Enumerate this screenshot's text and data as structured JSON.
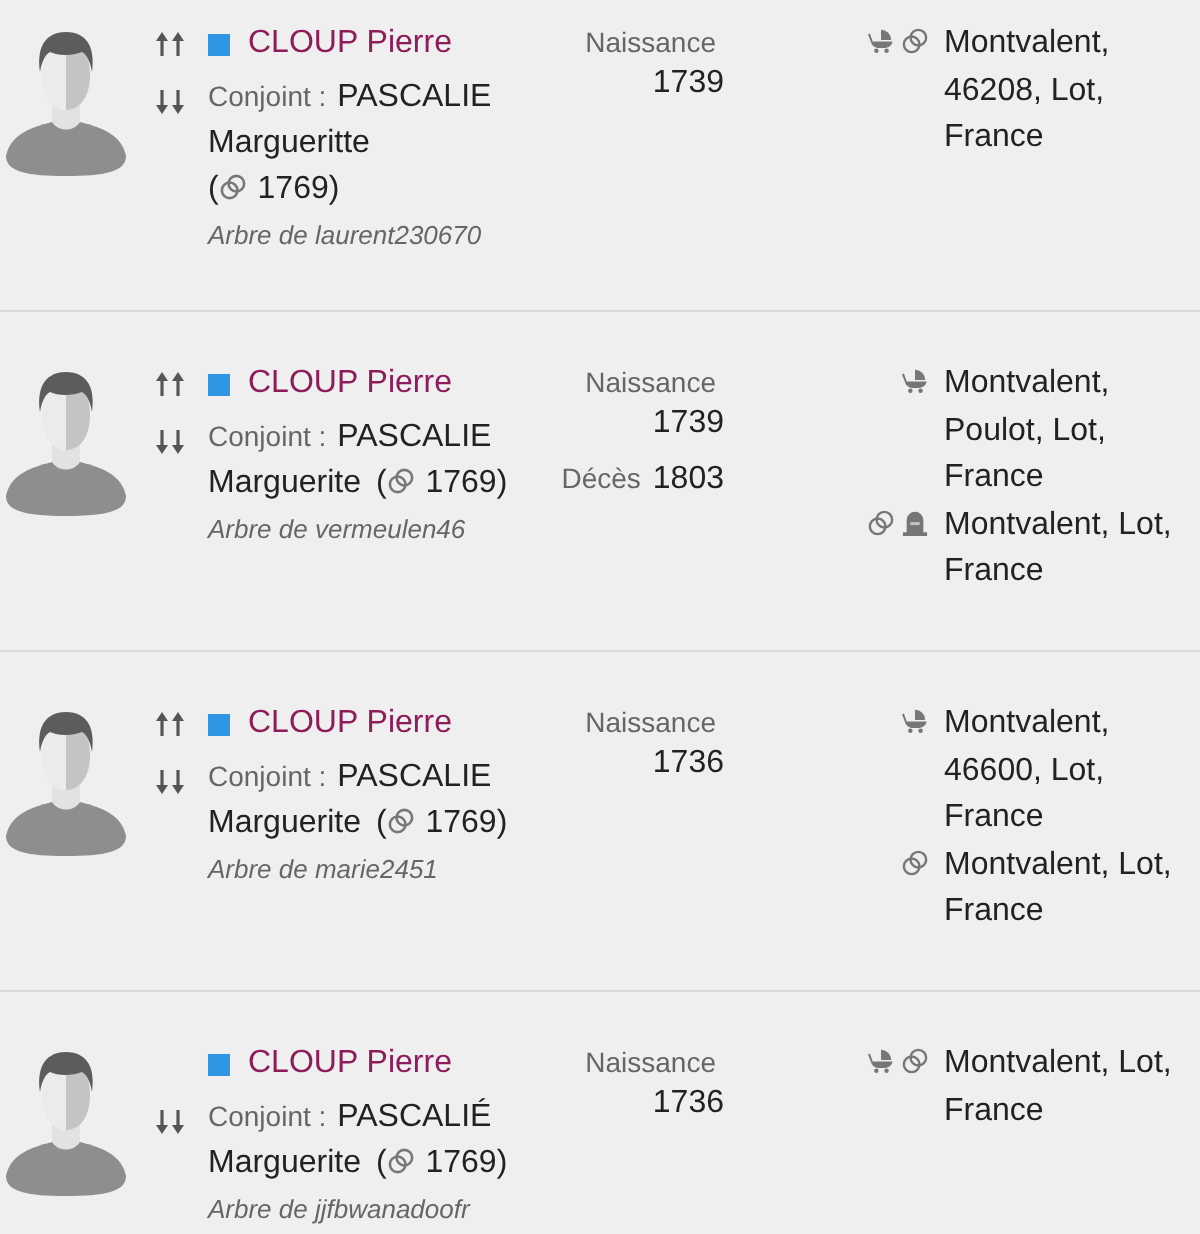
{
  "records": [
    {
      "has_parents": true,
      "has_children": true,
      "color": "#2f96e6",
      "name": "CLOUP Pierre",
      "spouse": {
        "label": "Conjoint :",
        "surname": "PASCALIE",
        "given": "Margueritte",
        "open": "(",
        "date": "1769)"
      },
      "tree": "Arbre de laurent230670",
      "dates": [
        {
          "kind": "birth",
          "label": "Naissance",
          "year": "1739"
        }
      ],
      "places": [
        {
          "events": [
            {
              "kind": "birth"
            },
            {
              "kind": "marriage"
            }
          ],
          "text": "Montvalent, 46208, Lot, France"
        }
      ]
    },
    {
      "has_parents": true,
      "has_children": true,
      "color": "#2f96e6",
      "name": "CLOUP Pierre",
      "spouse": {
        "label": "Conjoint :",
        "surname": "PASCALIE",
        "given": "Marguerite",
        "open": "(",
        "date": "1769)"
      },
      "tree": "Arbre de vermeulen46",
      "dates": [
        {
          "kind": "birth",
          "label": "Naissance",
          "year": "1739"
        },
        {
          "kind": "death",
          "label": "Décès",
          "year": "1803"
        }
      ],
      "places": [
        {
          "events": [
            {
              "kind": "birth"
            }
          ],
          "text": "Montvalent, Poulot, Lot, France"
        },
        {
          "events": [
            {
              "kind": "marriage"
            },
            {
              "kind": "burial"
            }
          ],
          "text": "Montvalent, Lot, France"
        }
      ]
    },
    {
      "has_parents": true,
      "has_children": true,
      "color": "#2f96e6",
      "name": "CLOUP Pierre",
      "spouse": {
        "label": "Conjoint :",
        "surname": "PASCALIE",
        "given": "Marguerite",
        "open": "(",
        "date": "1769)"
      },
      "tree": "Arbre de marie2451",
      "dates": [
        {
          "kind": "birth",
          "label": "Naissance",
          "year": "1736"
        }
      ],
      "places": [
        {
          "events": [
            {
              "kind": "birth"
            }
          ],
          "text": "Montvalent, 46600, Lot, France"
        },
        {
          "events": [
            {
              "kind": "marriage"
            }
          ],
          "text": "Montvalent, Lot, France"
        }
      ]
    },
    {
      "has_parents": false,
      "has_children": true,
      "color": "#2f96e6",
      "name": "CLOUP Pierre",
      "spouse": {
        "label": "Conjoint :",
        "surname": "PASCALIÉ",
        "given": "Marguerite",
        "open": "(",
        "date": "1769)"
      },
      "tree": "Arbre de jjfbwanadoofr",
      "dates": [
        {
          "kind": "birth",
          "label": "Naissance",
          "year": "1736"
        }
      ],
      "places": [
        {
          "events": [
            {
              "kind": "birth"
            },
            {
              "kind": "marriage"
            }
          ],
          "text": "Montvalent, Lot, France"
        }
      ]
    }
  ]
}
